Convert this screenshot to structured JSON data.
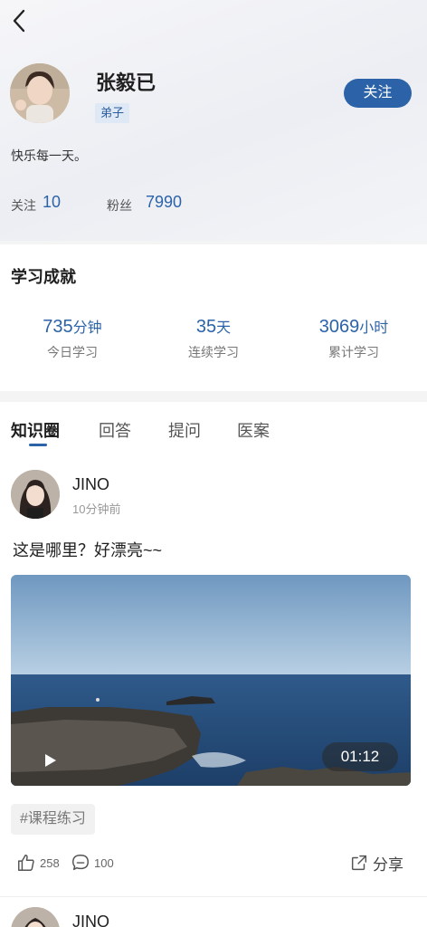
{
  "profile": {
    "name": "张毅已",
    "role_badge": "弟子",
    "follow_button": "关注",
    "bio": "快乐每一天。",
    "following_label": "关注",
    "following_count": "10",
    "followers_label": "粉丝",
    "followers_count": "7990"
  },
  "achievements": {
    "title": "学习成就",
    "items": [
      {
        "value": "735",
        "unit": "分钟",
        "label": "今日学习"
      },
      {
        "value": "35",
        "unit": "天",
        "label": "连续学习"
      },
      {
        "value": "3069",
        "unit": "小时",
        "label": "累计学习"
      }
    ]
  },
  "tabs": [
    {
      "label": "知识圈",
      "active": true
    },
    {
      "label": "回答",
      "active": false
    },
    {
      "label": "提问",
      "active": false
    },
    {
      "label": "医案",
      "active": false
    }
  ],
  "post": {
    "author": "JINO",
    "time": "10分钟前",
    "text": "这是哪里？好漂亮~~",
    "video_duration": "01:12",
    "tag": "#课程练习",
    "likes": "258",
    "comments": "100",
    "share_label": "分享"
  },
  "next_post": {
    "author": "JINO"
  },
  "icons": [
    "back-icon",
    "play-icon",
    "like-icon",
    "comment-icon",
    "share-icon"
  ],
  "colors": {
    "accent": "#2c63a8",
    "badge_bg": "#dfe9f6"
  }
}
